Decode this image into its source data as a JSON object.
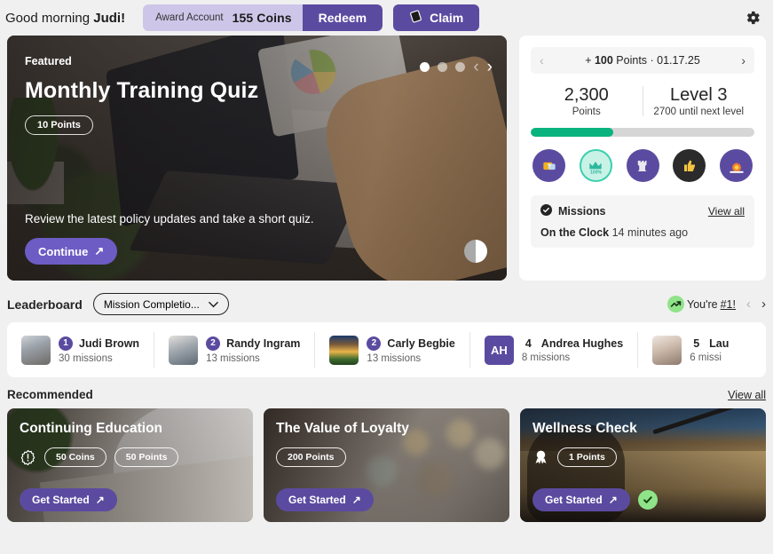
{
  "topbar": {
    "greeting_prefix": "Good morning ",
    "greeting_name": "Judi!",
    "award_label": "Award Account",
    "award_coins": "155 Coins",
    "redeem_label": "Redeem",
    "claim_label": "Claim",
    "settings_icon": "gear-icon"
  },
  "featured": {
    "tag": "Featured",
    "title": "Monthly Training Quiz",
    "points_chip": "10 Points",
    "description": "Review the latest policy updates and take a short quiz.",
    "cta_label": "Continue",
    "carousel": {
      "total": 3,
      "active_index": 0,
      "prev": "‹",
      "next": "›"
    },
    "contrast_toggle_icon": "contrast-toggle-icon"
  },
  "side_panel": {
    "points_banner": {
      "prefix": "+ ",
      "amount": "100",
      "suffix": " Points · 01.17.25",
      "prev": "‹",
      "next": "›"
    },
    "points_value": "2,300",
    "points_label": "Points",
    "level_value": "Level 3",
    "level_sub": "2700 until next level",
    "progress_percent": 37,
    "progress_color": "#09b37d",
    "badges": [
      {
        "name": "quiz-badge",
        "glyph": "❓",
        "bg": "#5b4ba0"
      },
      {
        "name": "hundred-percent-badge",
        "glyph": "♛",
        "bg": "#c9f2e6"
      },
      {
        "name": "rook-badge",
        "glyph": "♜",
        "bg": "#5b4ba0"
      },
      {
        "name": "thumbs-up-badge",
        "glyph": "👍",
        "bg": "#2b2b2b"
      },
      {
        "name": "sunrise-badge",
        "glyph": "◔",
        "bg": "#5b4ba0"
      }
    ],
    "missions_title": "Missions",
    "missions_view_all": "View all",
    "mission_name": "On the Clock",
    "mission_time": "14 minutes ago"
  },
  "leaderboard": {
    "title": "Leaderboard",
    "filter_value": "Mission Completio...",
    "filter_caret": "⌵",
    "youre_prefix": "You're ",
    "youre_rank": "#1!",
    "prev": "‹",
    "next": "›",
    "entries": [
      {
        "rank": "1",
        "rank_style": "circle",
        "name": "Judi Brown",
        "missions": "30 missions",
        "avatar": "photo",
        "avatar_class": "lb-a1"
      },
      {
        "rank": "2",
        "rank_style": "circle",
        "name": "Randy Ingram",
        "missions": "13 missions",
        "avatar": "photo",
        "avatar_class": "lb-a2"
      },
      {
        "rank": "2",
        "rank_style": "circle",
        "name": "Carly Begbie",
        "missions": "13 missions",
        "avatar": "photo",
        "avatar_class": "lb-a3"
      },
      {
        "rank": "4",
        "rank_style": "plain",
        "name": "Andrea Hughes",
        "missions": "8 missions",
        "avatar": "initials",
        "initials": "AH"
      },
      {
        "rank": "5",
        "rank_style": "plain",
        "name": "Lau",
        "missions": "6 missi",
        "avatar": "photo",
        "avatar_class": "lb-a5"
      }
    ]
  },
  "recommended": {
    "title": "Recommended",
    "view_all": "View all",
    "cards": [
      {
        "name": "Continuing Education",
        "icon": "alert-badge-icon",
        "chips": [
          "50 Coins",
          "50 Points"
        ],
        "cta_label": "Get Started",
        "completed": false,
        "bg_class": "bg-edu"
      },
      {
        "name": "The Value of Loyalty",
        "icon": "",
        "chips": [
          "200 Points"
        ],
        "cta_label": "Get Started",
        "completed": false,
        "bg_class": "bg-loy"
      },
      {
        "name": "Wellness Check",
        "icon": "award-ribbon-icon",
        "chips": [
          "1 Points"
        ],
        "cta_label": "Get Started",
        "completed": true,
        "bg_class": "bg-well"
      }
    ]
  },
  "colors": {
    "brand_purple": "#5b4ba0",
    "light_purple": "#cdc6e8",
    "accent_green": "#09b37d",
    "badge_green": "#8fe388",
    "page_bg": "#f0f0f0"
  }
}
